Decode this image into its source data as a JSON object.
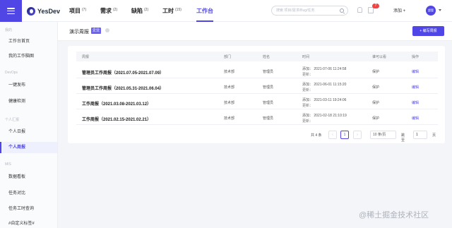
{
  "header": {
    "logo_text": "YesDev",
    "nav": [
      {
        "label": "项目",
        "count": "(7)"
      },
      {
        "label": "需求",
        "count": "(2)"
      },
      {
        "label": "缺陷",
        "count": "(2)"
      },
      {
        "label": "工时",
        "count": "(15)"
      },
      {
        "label": "工作台",
        "count": ""
      }
    ],
    "search_placeholder": "搜索 项目/需求/Bug/任务",
    "notification_badge": "7",
    "add_label": "添加 +",
    "avatar_text": "超管"
  },
  "sidebar": {
    "sections": [
      {
        "title": "我的",
        "items": [
          "工作台首页",
          "我的工作脑图"
        ]
      },
      {
        "title": "DevOps",
        "items": [
          "一键发布",
          "健康检测"
        ]
      },
      {
        "title": "个人汇报",
        "items": [
          "个人日报",
          "个人周报"
        ]
      },
      {
        "title": "MIS",
        "items": [
          "数据看板",
          "任务对比",
          "任务工时查询",
          "#自定义标签#"
        ]
      }
    ],
    "active_item": "个人周报"
  },
  "main": {
    "title": "演示周报",
    "tag": "企业",
    "write_button": "+ 编写周报",
    "table": {
      "columns": [
        "周报",
        "部门",
        "姓名",
        "时间",
        "谁可以看",
        "操作"
      ],
      "rows": [
        {
          "title": "管理员工作周报（2021.07.05-2021.07.09）",
          "dept": "技术部",
          "name": "管理员",
          "added": "添加： 2021-07-06 11:24:58",
          "updated": "更新：",
          "visibility": "保护",
          "action": "编辑"
        },
        {
          "title": "管理员工作周报（2021.05.31-2021.06.04）",
          "dept": "技术部",
          "name": "管理员",
          "added": "添加： 2021-06-01 11:15:20",
          "updated": "更新：",
          "visibility": "保护",
          "action": "编辑"
        },
        {
          "title": "工作周报（2021.03.08-2021.03.12）",
          "dept": "技术部",
          "name": "管理员",
          "added": "添加： 2021-03-11 19:24:06",
          "updated": "更新：",
          "visibility": "保护",
          "action": "编辑"
        },
        {
          "title": "工作周报（2021.02.15-2021.02.21）",
          "dept": "技术部",
          "name": "管理员",
          "added": "添加： 2021-02-18 21:10:19",
          "updated": "更新：",
          "visibility": "保护",
          "action": "编辑"
        }
      ]
    },
    "pagination": {
      "total": "共 4 条",
      "prev": "‹",
      "current": "1",
      "next": "›",
      "page_size": "10 条/页",
      "jump_label": "跳至",
      "jump_value": "1",
      "unit": "页"
    }
  },
  "watermark": "@稀土掘金技术社区"
}
